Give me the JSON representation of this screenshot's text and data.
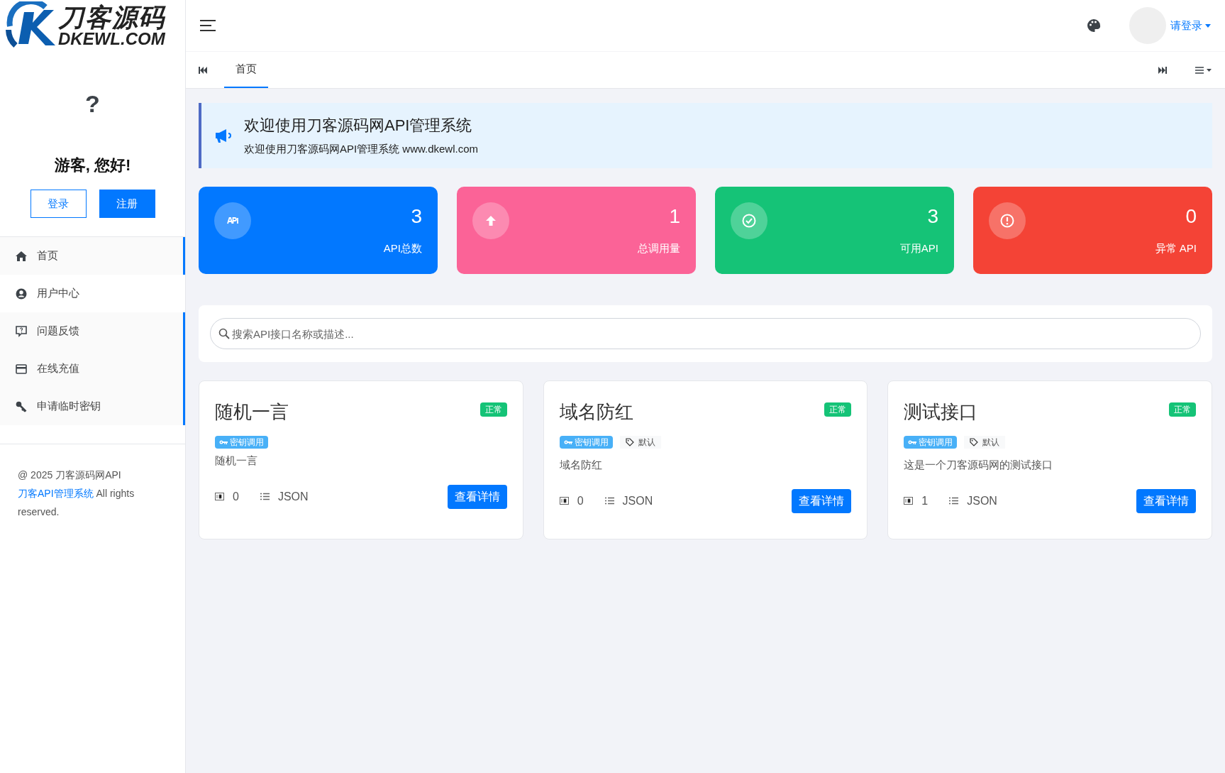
{
  "logo": {
    "title": "刀客源码",
    "subtitle": "DKEWL.COM"
  },
  "header": {
    "user_menu": "请登录"
  },
  "tabs": [
    {
      "label": "首页",
      "selected": true
    }
  ],
  "sidebar": {
    "avatar": "?",
    "greeting": "游客, 您好!",
    "login": "登录",
    "register": "注册",
    "items": [
      {
        "label": "首页",
        "highlighted": true
      },
      {
        "label": "用户中心",
        "highlighted": false
      },
      {
        "label": "问题反馈",
        "highlighted": true
      },
      {
        "label": "在线充值",
        "highlighted": true
      },
      {
        "label": "申请临时密钥",
        "highlighted": true
      }
    ],
    "footer": {
      "prefix": "@ 2025 刀客源码网API",
      "link": "刀客API管理系统",
      "suffix": "All rights reserved."
    }
  },
  "notice": {
    "title": "欢迎使用刀客源码网API管理系统",
    "text": "欢迎使用刀客源码网API管理系统 www.dkewl.com"
  },
  "stats": [
    {
      "value": "3",
      "label": "API总数",
      "color": "#0278ff"
    },
    {
      "value": "1",
      "label": "总调用量",
      "color": "#fb6397"
    },
    {
      "value": "3",
      "label": "可用API",
      "color": "#15c377"
    },
    {
      "value": "0",
      "label": "异常 API",
      "color": "#f44336"
    }
  ],
  "search": {
    "placeholder": "搜索API接口名称或描述..."
  },
  "apis": [
    {
      "title": "随机一言",
      "status": "正常",
      "auth": "密钥调用",
      "description": "随机一言",
      "calls": "0",
      "format": "JSON",
      "button": "查看详情"
    },
    {
      "title": "域名防红",
      "status": "正常",
      "auth": "密钥调用",
      "category": "默认",
      "description": "域名防红",
      "calls": "0",
      "format": "JSON",
      "button": "查看详情"
    },
    {
      "title": "测试接口",
      "status": "正常",
      "auth": "密钥调用",
      "category": "默认",
      "description": "这是一个刀客源码网的测试接口",
      "calls": "1",
      "format": "JSON",
      "button": "查看详情"
    }
  ]
}
